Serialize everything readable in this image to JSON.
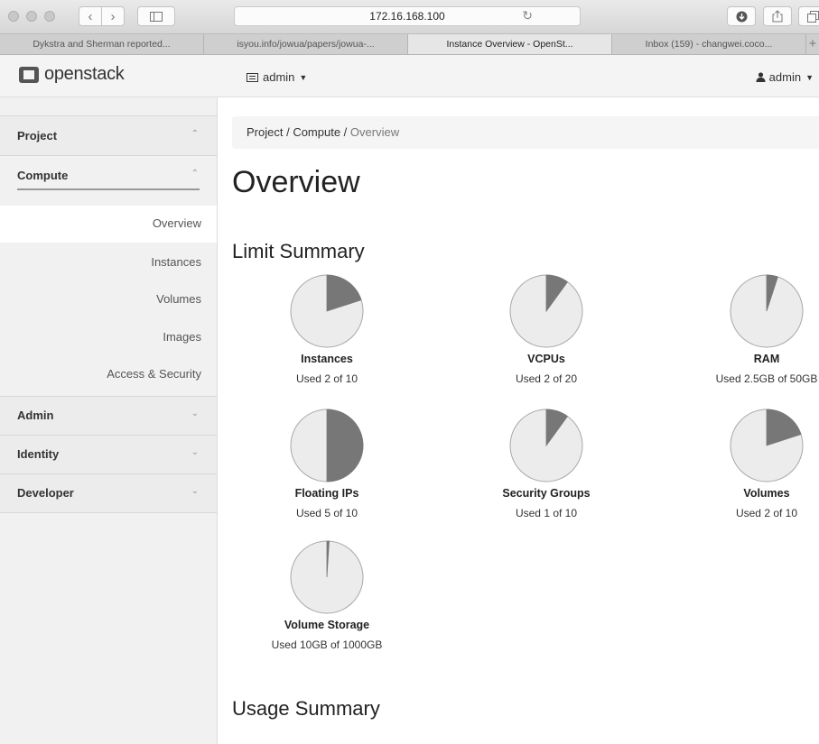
{
  "browser": {
    "address": "172.16.168.100",
    "tabs": [
      {
        "title": "Dykstra and Sherman reported...",
        "active": false
      },
      {
        "title": "isyou.info/jowua/papers/jowua-...",
        "active": false
      },
      {
        "title": "Instance Overview - OpenSt...",
        "active": true
      },
      {
        "title": "Inbox (159) - changwei.coco...",
        "active": false
      }
    ],
    "new_tab": "+"
  },
  "header": {
    "logo_text": "openstack",
    "project_label": "admin",
    "user_label": "admin"
  },
  "sidebar": {
    "project": "Project",
    "compute": "Compute",
    "items": [
      "Overview",
      "Instances",
      "Volumes",
      "Images",
      "Access & Security"
    ],
    "admin": "Admin",
    "identity": "Identity",
    "developer": "Developer"
  },
  "breadcrumb": {
    "project": "Project",
    "sep1": " / ",
    "compute": "Compute",
    "sep2": " / ",
    "current": "Overview"
  },
  "page_title": "Overview",
  "limit_heading": "Limit Summary",
  "usage_heading": "Usage Summary",
  "colors": {
    "pie_fill": "#ececec",
    "pie_used": "#777777",
    "pie_stroke": "#a8a8a8"
  },
  "chart_data": {
    "type": "pie",
    "charts": [
      {
        "title": "Instances",
        "label": "Used 2 of 10",
        "used": 2,
        "total": 10
      },
      {
        "title": "VCPUs",
        "label": "Used 2 of 20",
        "used": 2,
        "total": 20
      },
      {
        "title": "RAM",
        "label": "Used 2.5GB of 50GB",
        "used": 2.5,
        "total": 50
      },
      {
        "title": "Floating IPs",
        "label": "Used 5 of 10",
        "used": 5,
        "total": 10
      },
      {
        "title": "Security Groups",
        "label": "Used 1 of 10",
        "used": 1,
        "total": 10
      },
      {
        "title": "Volumes",
        "label": "Used 2 of 10",
        "used": 2,
        "total": 10
      },
      {
        "title": "Volume Storage",
        "label": "Used 10GB of 1000GB",
        "used": 10,
        "total": 1000
      }
    ]
  }
}
